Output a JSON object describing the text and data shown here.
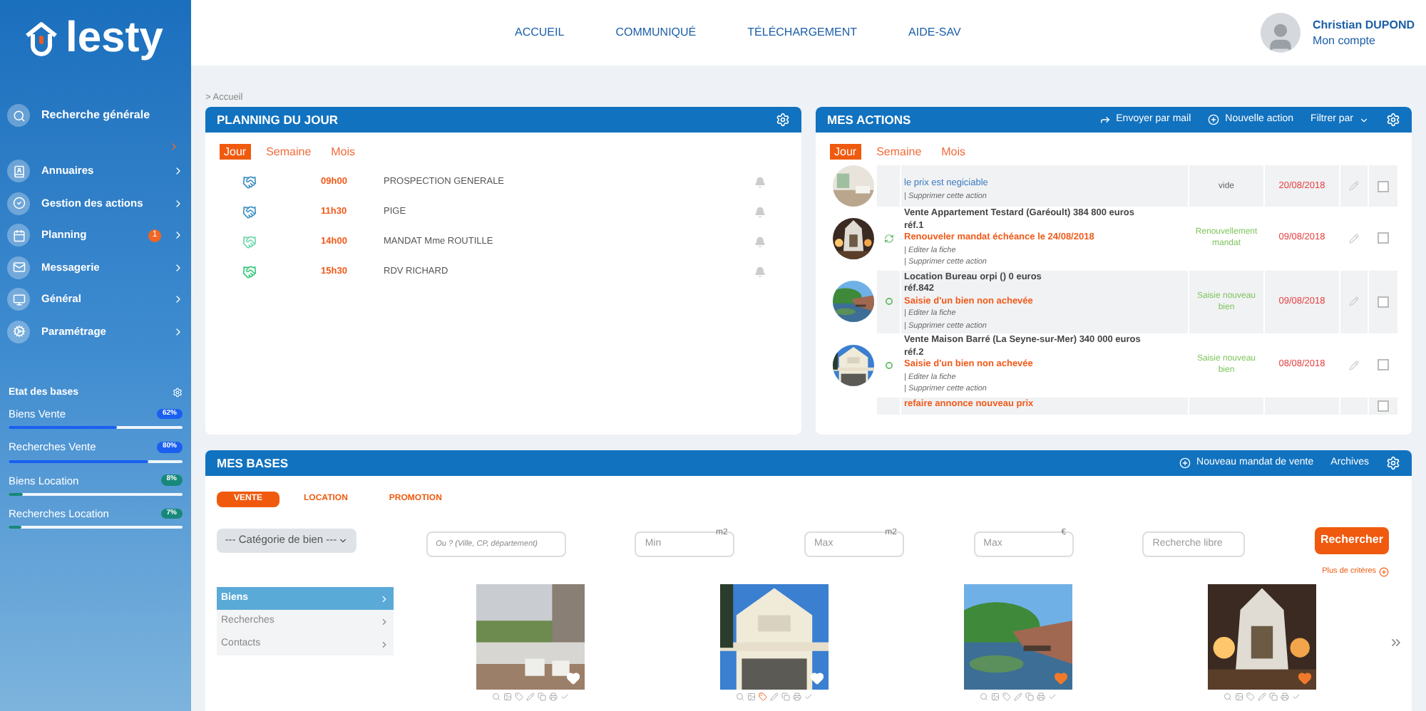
{
  "logo": {
    "text": "lesty"
  },
  "header": {
    "links": [
      {
        "label": "ACCUEIL"
      },
      {
        "label": "COMMUNIQUÉ"
      },
      {
        "label": "TÉLÉCHARGEMENT"
      },
      {
        "label": "AIDE-SAV"
      }
    ],
    "user": {
      "name": "Christian DUPOND",
      "link": "Mon compte"
    }
  },
  "breadcrumb": "> Accueil",
  "sidebar": {
    "search": "Recherche générale",
    "items": [
      {
        "label": "Annuaires"
      },
      {
        "label": "Gestion des actions"
      },
      {
        "label": "Planning",
        "badge": "1"
      },
      {
        "label": "Messagerie"
      },
      {
        "label": "Général"
      },
      {
        "label": "Paramétrage"
      }
    ],
    "bases": {
      "title": "Etat des bases",
      "items": [
        {
          "label": "Biens Vente",
          "reading": "62%",
          "level": 0.62,
          "color": "#1a5ff0"
        },
        {
          "label": "Recherches Vente",
          "reading": "80%",
          "level": 0.8,
          "color": "#1a5ff0"
        },
        {
          "label": "Biens Location",
          "reading": "8%",
          "level": 0.08,
          "color": "#17887a"
        },
        {
          "label": "Recherches Location",
          "reading": "7%",
          "level": 0.07,
          "color": "#17887a"
        }
      ]
    }
  },
  "planning": {
    "title": "PLANNING DU JOUR",
    "tabs": [
      {
        "label": "Jour",
        "selected": true
      },
      {
        "label": "Semaine",
        "selected": false
      },
      {
        "label": "Mois",
        "selected": false
      }
    ],
    "events": [
      {
        "time": "09h00",
        "label": "PROSPECTION GENERALE",
        "color": "#3d8fc4"
      },
      {
        "time": "11h30",
        "label": "PIGE",
        "color": "#3d8fc4"
      },
      {
        "time": "14h00",
        "label": "MANDAT Mme ROUTILLE",
        "color": "#6fd6ab"
      },
      {
        "time": "15h30",
        "label": "RDV RICHARD",
        "color": "#37c77a"
      }
    ]
  },
  "actions": {
    "title": "MES ACTIONS",
    "toolbar": [
      {
        "label": "Envoyer par mail"
      },
      {
        "label": "Nouvelle action"
      },
      {
        "label": "Filtrer par"
      }
    ],
    "tabs": [
      {
        "label": "Jour",
        "selected": true
      },
      {
        "label": "Semaine",
        "selected": false
      },
      {
        "label": "Mois",
        "selected": false
      }
    ],
    "rows": [
      {
        "kind": "note",
        "note": "le prix est negiciable",
        "links": [
          "| Supprimer cette action"
        ],
        "status": "vide",
        "date": "20/08/2018",
        "checked": false
      },
      {
        "kind": "renewal",
        "title": "Vente Appartement Testard (Garéoult) 384 800 euros",
        "ref": "réf.1",
        "alert": "Renouveler mandat échéance le 24/08/2018",
        "links": [
          "| Editer la fiche",
          "| Supprimer cette action"
        ],
        "status": "Renouvellement mandat",
        "date": "09/08/2018",
        "checked": false
      },
      {
        "kind": "entry",
        "title": "Location Bureau orpi () 0 euros",
        "ref": "réf.842",
        "alert": "Saisie d'un bien non achevée",
        "links": [
          "| Editer la fiche",
          "| Supprimer cette action"
        ],
        "status": "Saisie nouveau bien",
        "date": "09/08/2018",
        "checked": false
      },
      {
        "kind": "entry",
        "title": "Vente Maison Barré (La Seyne-sur-Mer) 340 000 euros",
        "ref": "réf.2",
        "alert": "Saisie d'un bien non achevée",
        "links": [
          "| Editer la fiche",
          "| Supprimer cette action"
        ],
        "status": "Saisie nouveau bien",
        "date": "08/08/2018",
        "checked": false
      },
      {
        "kind": "note",
        "alert": "refaire annonce nouveau prix",
        "checked": false
      }
    ]
  },
  "bases": {
    "title": "MES BASES",
    "toolbar": [
      {
        "label": "Nouveau mandat de vente"
      },
      {
        "label": "Archives"
      }
    ],
    "tabs": [
      {
        "label": "VENTE",
        "selected": true
      },
      {
        "label": "LOCATION",
        "selected": false
      },
      {
        "label": "PROMOTION",
        "selected": false
      }
    ],
    "category": "--- Catégorie de bien ---",
    "fields": [
      {
        "placeholder": "Ou ? (Ville, CP, département)",
        "kind": "place"
      },
      {
        "placeholder": "Min",
        "unit": "m2",
        "kind": "num"
      },
      {
        "placeholder": "Max",
        "unit": "m2",
        "kind": "num"
      },
      {
        "placeholder": "Max",
        "unit": "€",
        "kind": "num"
      },
      {
        "placeholder": "Recherche libre",
        "kind": "text"
      }
    ],
    "search_button": "Rechercher",
    "more": "Plus de critères",
    "menu": [
      {
        "label": "Biens",
        "selected": true
      },
      {
        "label": "Recherches",
        "selected": false
      },
      {
        "label": "Contacts",
        "selected": false
      }
    ],
    "listings": [
      {
        "favorite": false,
        "tagged": false
      },
      {
        "favorite": false,
        "tagged": true
      },
      {
        "favorite": true,
        "tagged": false
      },
      {
        "favorite": true,
        "tagged": false
      }
    ]
  }
}
